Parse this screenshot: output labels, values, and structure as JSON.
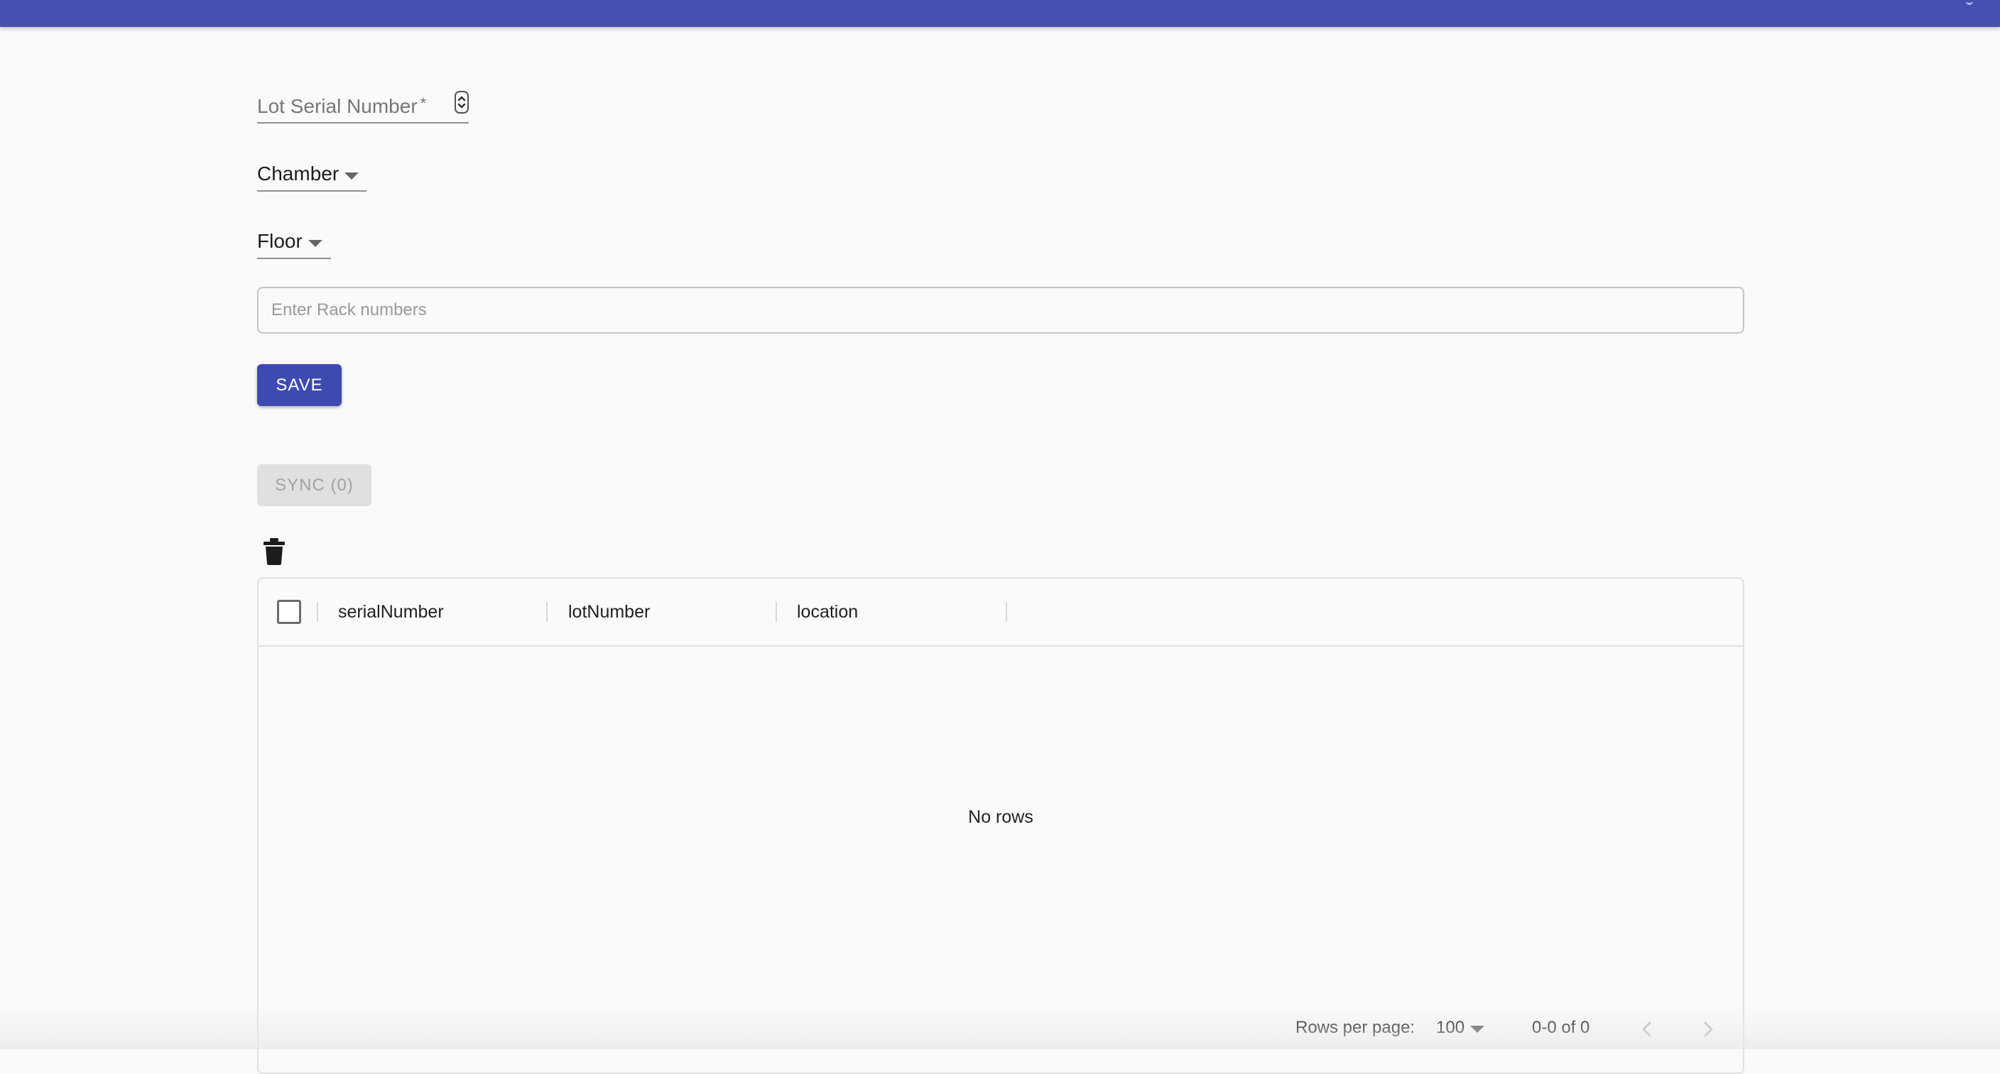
{
  "form": {
    "lot_serial_label": "Lot Serial Number",
    "lot_serial_required": "*",
    "chamber_label": "Chamber",
    "floor_label": "Floor",
    "rack_placeholder": "Enter Rack numbers",
    "save_label": "SAVE",
    "sync_label": "SYNC (0)"
  },
  "icons": {
    "delete": "trash-icon",
    "stepper": "stepper-icon",
    "dropdown": "chevron-down-icon",
    "prev": "chevron-left-icon",
    "next": "chevron-right-icon"
  },
  "table": {
    "columns": [
      "serialNumber",
      "lotNumber",
      "location"
    ],
    "rows": [],
    "empty_message": "No rows"
  },
  "pagination": {
    "rows_per_page_label": "Rows per page:",
    "rows_per_page_value": "100",
    "range_text": "0-0 of 0"
  },
  "colors": {
    "primary": "#3f4ab0",
    "topbar": "#4650b4",
    "disabled_bg": "#e0e0e0",
    "disabled_text": "#a2a2a2"
  }
}
